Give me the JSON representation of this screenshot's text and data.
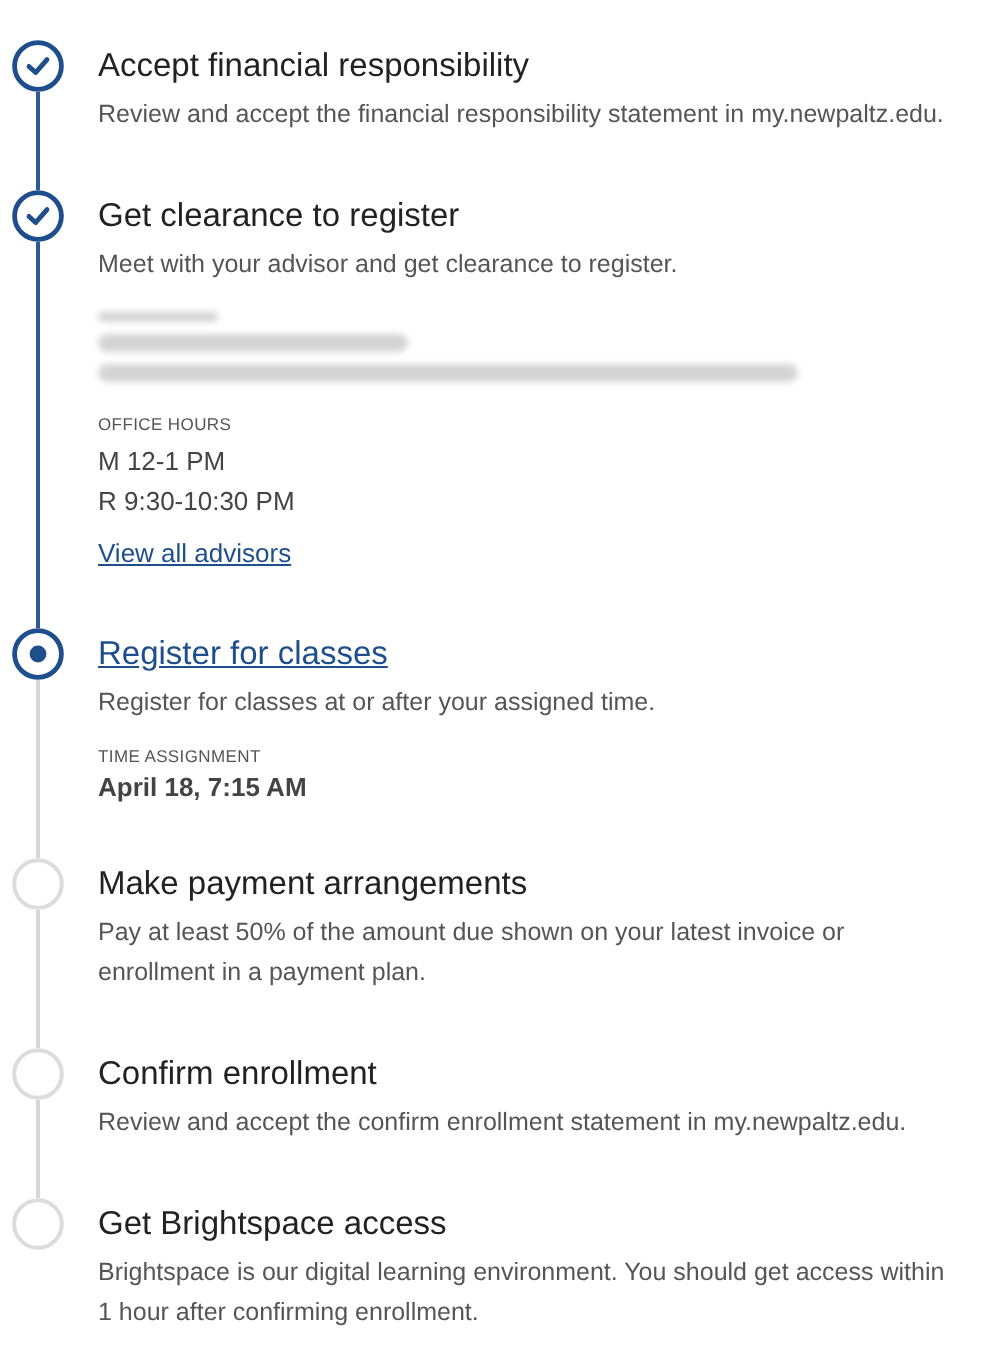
{
  "steps": [
    {
      "completed": true,
      "current": false,
      "title": "Accept financial responsibility",
      "description": "Review and accept the financial responsibility statement in my.newpaltz.edu."
    },
    {
      "completed": true,
      "current": false,
      "title": "Get clearance to register",
      "description": "Meet with your advisor and get clearance to register.",
      "advisor": {
        "office_hours_label": "OFFICE HOURS",
        "hours": [
          "M 12-1 PM",
          "R 9:30-10:30 PM"
        ],
        "link": "View all advisors"
      }
    },
    {
      "completed": false,
      "current": true,
      "title": "Register for classes",
      "description": "Register for classes at or after your assigned time.",
      "time_assignment": {
        "label": "TIME ASSIGNMENT",
        "value": "April 18, 7:15 AM"
      }
    },
    {
      "completed": false,
      "current": false,
      "title": "Make payment arrangements",
      "description": "Pay at least 50% of the amount due shown on your latest invoice or enrollment in a payment plan."
    },
    {
      "completed": false,
      "current": false,
      "title": "Confirm enrollment",
      "description": "Review and accept the confirm enrollment statement in my.newpaltz.edu."
    },
    {
      "completed": false,
      "current": false,
      "title": "Get Brightspace access",
      "description": "Brightspace is our digital learning environment. You should get access within 1 hour after confirming enrollment."
    }
  ]
}
